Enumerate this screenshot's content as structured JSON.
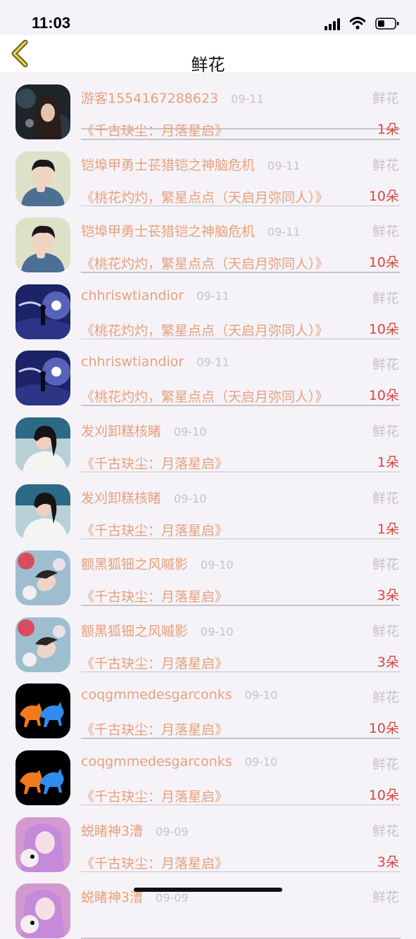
{
  "status": {
    "time": "11:03"
  },
  "nav": {
    "title": "鲜花"
  },
  "list": [
    {
      "user": "游客1554167288623",
      "date": "09-11",
      "type": "鲜花",
      "book": "《千古玦尘：月落星启》",
      "count": "1朵",
      "avatar": "avatar-dark-girl"
    },
    {
      "user": "铠埠甲勇士苌猎铠之神脑危机",
      "date": "09-11",
      "type": "鲜花",
      "book": "《桃花灼灼，繁星点点（天启月弥同人）》",
      "count": "10朵",
      "avatar": "avatar-boy-denim"
    },
    {
      "user": "铠埠甲勇士苌猎铠之神脑危机",
      "date": "09-11",
      "type": "鲜花",
      "book": "《桃花灼灼，繁星点点（天启月弥同人）》",
      "count": "10朵",
      "avatar": "avatar-boy-denim"
    },
    {
      "user": "chhriswtiandior",
      "date": "09-11",
      "type": "鲜花",
      "book": "《桃花灼灼，繁星点点（天启月弥同人）》",
      "count": "10朵",
      "avatar": "avatar-night-sky"
    },
    {
      "user": "chhriswtiandior",
      "date": "09-11",
      "type": "鲜花",
      "book": "《桃花灼灼，繁星点点（天启月弥同人）》",
      "count": "10朵",
      "avatar": "avatar-night-sky"
    },
    {
      "user": "发刈卸糕核睹",
      "date": "09-10",
      "type": "鲜花",
      "book": "《千古玦尘：月落星启》",
      "count": "1朵",
      "avatar": "avatar-girl-white"
    },
    {
      "user": "发刈卸糕核睹",
      "date": "09-10",
      "type": "鲜花",
      "book": "《千古玦尘：月落星启》",
      "count": "1朵",
      "avatar": "avatar-girl-white"
    },
    {
      "user": "额黑狐钿之风嘁影",
      "date": "09-10",
      "type": "鲜花",
      "book": "《千古玦尘：月落星启》",
      "count": "3朵",
      "avatar": "avatar-girl-flowers"
    },
    {
      "user": "额黑狐钿之风嘁影",
      "date": "09-10",
      "type": "鲜花",
      "book": "《千古玦尘：月落星启》",
      "count": "3朵",
      "avatar": "avatar-girl-flowers"
    },
    {
      "user": "coqgmmedesgarconks",
      "date": "09-10",
      "type": "鲜花",
      "book": "《千古玦尘：月落星启》",
      "count": "10朵",
      "avatar": "avatar-horses"
    },
    {
      "user": "coqgmmedesgarconks",
      "date": "09-10",
      "type": "鲜花",
      "book": "《千古玦尘：月落星启》",
      "count": "10朵",
      "avatar": "avatar-horses"
    },
    {
      "user": "蜕睹神3漕",
      "date": "09-09",
      "type": "鲜花",
      "book": "《千古玦尘：月落星启》",
      "count": "3朵",
      "avatar": "avatar-doll-pink"
    },
    {
      "user": "蜕睹神3漕",
      "date": "09-09",
      "type": "鲜花",
      "book": "",
      "count": "",
      "avatar": "avatar-doll-pink"
    }
  ]
}
